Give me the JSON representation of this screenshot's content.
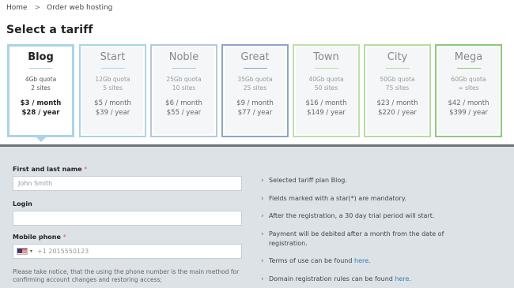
{
  "breadcrumb": {
    "home": "Home",
    "separator": ">",
    "current": "Order web hosting"
  },
  "page_title": "Select a tariff",
  "colors": {
    "blog": "#a9d4ea",
    "start": "#a9d4ea",
    "noble": "#b6c8dc",
    "great": "#8aa6c8",
    "town": "#bde0a8",
    "city": "#b6dba0",
    "mega": "#8fc77a"
  },
  "plans": [
    {
      "name": "Blog",
      "quota": "4Gb quota",
      "sites": "2 sites",
      "month": "$3 / month",
      "year": "$28 / year",
      "selected": true
    },
    {
      "name": "Start",
      "quota": "12Gb quota",
      "sites": "5 sites",
      "month": "$5 / month",
      "year": "$39 / year"
    },
    {
      "name": "Noble",
      "quota": "25Gb quota",
      "sites": "10 sites",
      "month": "$6 / month",
      "year": "$55 / year"
    },
    {
      "name": "Great",
      "quota": "35Gb quota",
      "sites": "25 sites",
      "month": "$9 / month",
      "year": "$77 / year"
    },
    {
      "name": "Town",
      "quota": "40Gb quota",
      "sites": "50 sites",
      "month": "$16 / month",
      "year": "$149 / year"
    },
    {
      "name": "City",
      "quota": "50Gb quota",
      "sites": "75 sites",
      "month": "$23 / month",
      "year": "$220 / year"
    },
    {
      "name": "Mega",
      "quota": "60Gb quota",
      "sites": "∞ sites",
      "month": "$42 / month",
      "year": "$399 / year"
    }
  ],
  "form": {
    "name_label": "First and last name",
    "required_mark": "*",
    "name_placeholder": "John Smith",
    "login_label": "Login",
    "login_value": "",
    "phone_label": "Mobile phone",
    "phone_caret": "▾",
    "phone_placeholder": "+1 2015550123",
    "notice": "Please take notice, that the using the phone number is the main method for confirming account changes and restoring access;"
  },
  "info": {
    "item1": "Selected tariff plan Blog.",
    "item2": "Fields marked with a star(*) are mandatory.",
    "item3": "After the registration, a 30 day trial period will start.",
    "item4": "Payment will be debited after a month from the date of registration.",
    "item5_text": "Terms of use can be found ",
    "item5_link": "here",
    "item6_text": "Domain registration rules can be found ",
    "item6_link": "here",
    "period": "."
  }
}
